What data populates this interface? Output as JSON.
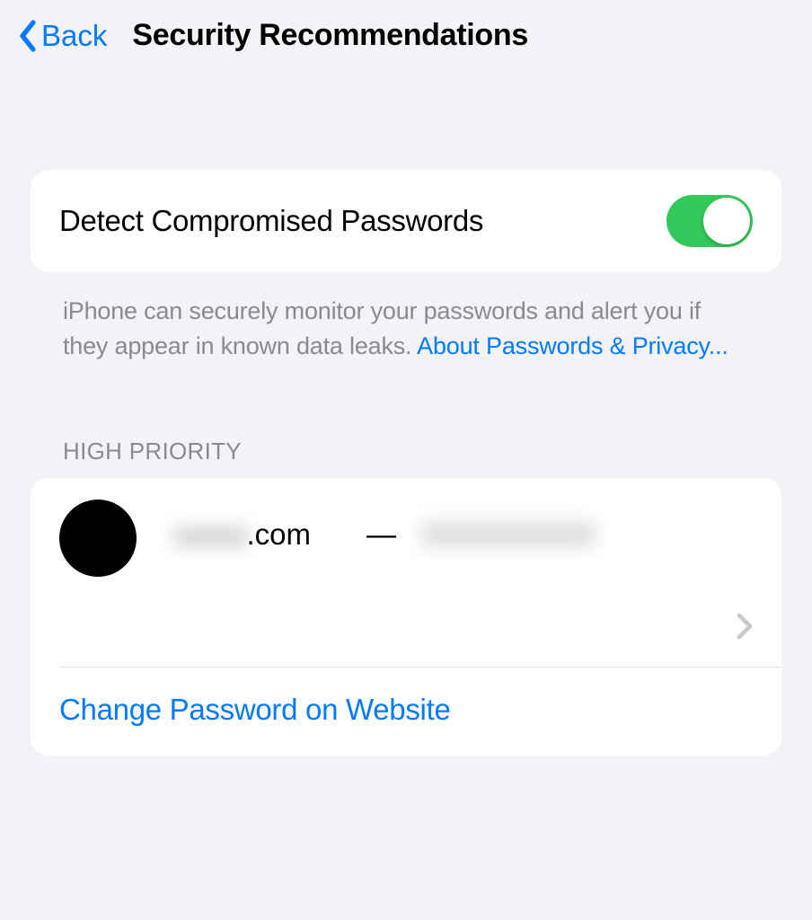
{
  "nav": {
    "back_label": "Back",
    "title": "Security Recommendations"
  },
  "detect_cell": {
    "label": "Detect Compromised Passwords",
    "toggle_on": true
  },
  "footer": {
    "text": "iPhone can securely monitor your passwords and alert you if they appear in known data leaks. ",
    "link": "About Passwords & Privacy..."
  },
  "section": {
    "header": "HIGH PRIORITY"
  },
  "entry": {
    "domain_prefix_masked": "xxxxx",
    "domain_suffix": ".com",
    "separator": "—",
    "account_masked": "XXXXXXXX"
  },
  "action": {
    "label": "Change Password on Website"
  }
}
